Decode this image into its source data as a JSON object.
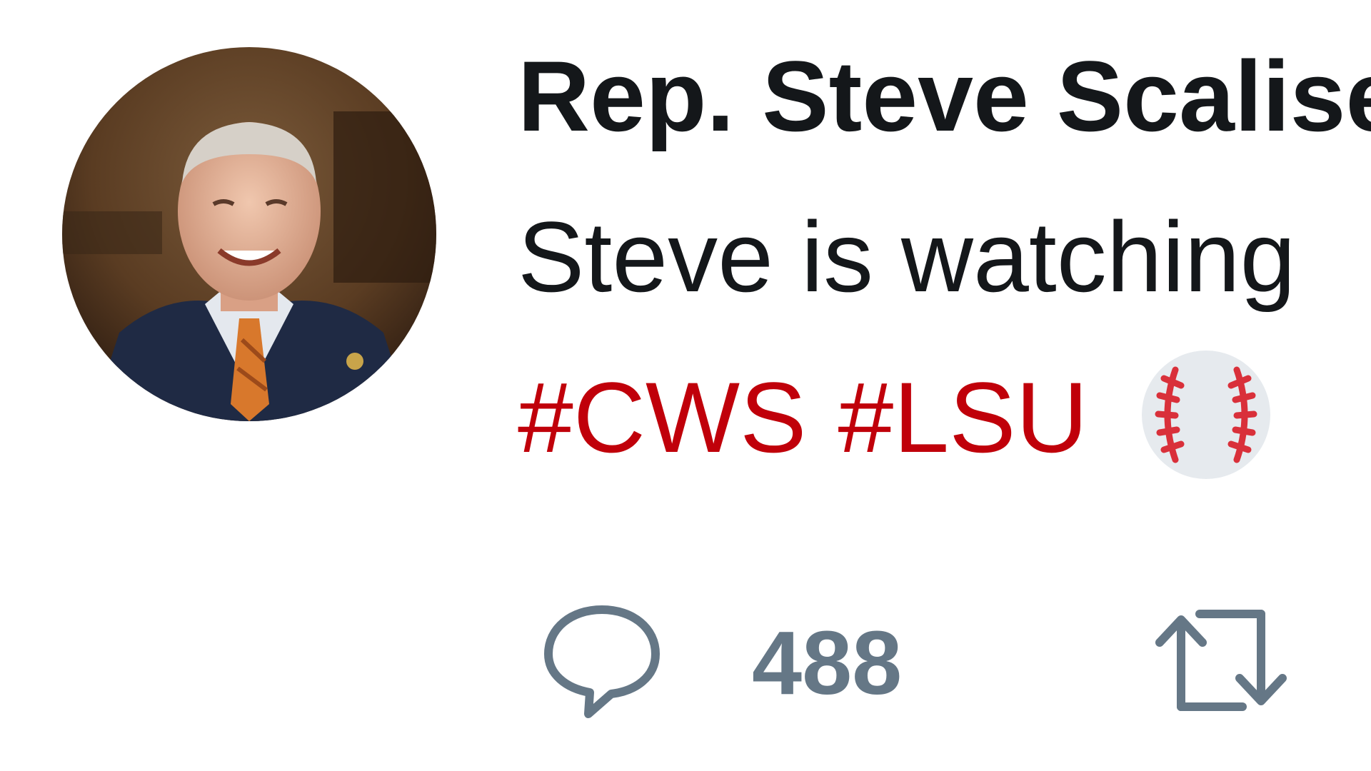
{
  "tweet": {
    "author": {
      "display_name": "Rep. Steve Scalise",
      "avatar_icon": "profile-photo-avatar"
    },
    "text_line": "Steve is watching",
    "hashtags": [
      "#CWS",
      "#LSU"
    ],
    "emoji_icon": "baseball-icon",
    "colors": {
      "text": "#14171a",
      "hashtag": "#c0000a",
      "action": "#657786"
    },
    "actions": {
      "reply_icon": "reply-icon",
      "reply_count": "488",
      "retweet_icon": "retweet-icon"
    }
  }
}
